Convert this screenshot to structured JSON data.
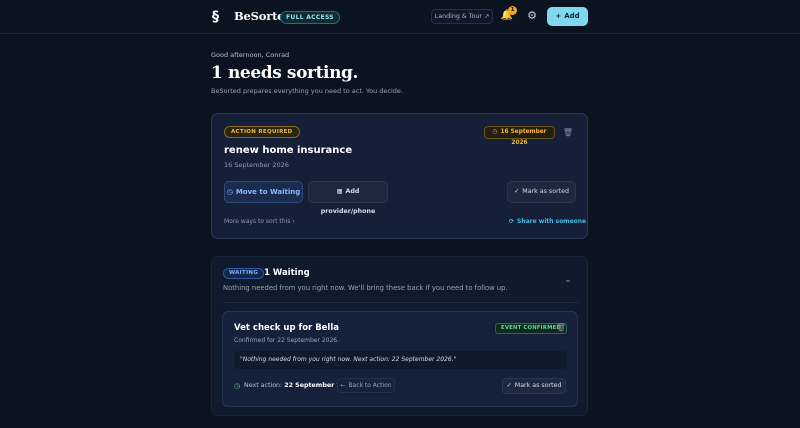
{
  "header": {
    "brand": "BeSorted",
    "access_badge": "FULL ACCESS",
    "tour_label": "Landing & Tour",
    "notification_count": "1",
    "add_label": "Add"
  },
  "greeting": {
    "salutation": "Good afternoon, Conrad",
    "headline": "1 needs sorting.",
    "subtitle": "BeSorted prepares everything you need to act. You decide."
  },
  "action_card": {
    "status": "ACTION REQUIRED",
    "due_date": "16 September 2026",
    "title": "renew home insurance",
    "date": "16 September 2026",
    "move_waiting": "Move to Waiting",
    "add_provider": "Add provider/phone",
    "mark_sorted": "Mark as sorted",
    "more_ways": "More ways to sort this",
    "share": "Share with someone"
  },
  "waiting": {
    "badge": "WAITING",
    "count_label": "1 Waiting",
    "note": "Nothing needed from you right now. We'll bring these back if you need to follow up.",
    "item": {
      "title": "Vet check up for Bella",
      "confirmed": "Confirmed for 22 September 2026.",
      "status": "EVENT CONFIRMED",
      "quote": "\"Nothing needed from you right now. Next action: 22 September 2026.\"",
      "next_label": "Next action:",
      "next_date": "22 September 2026",
      "back_label": "Back to Action",
      "mark_sorted": "Mark as sorted"
    }
  },
  "colors": {
    "background": "#0b1220",
    "accent": "#7fd8ef",
    "warning": "#f0b93a",
    "success": "#61d394",
    "info": "#7fb0ff"
  }
}
